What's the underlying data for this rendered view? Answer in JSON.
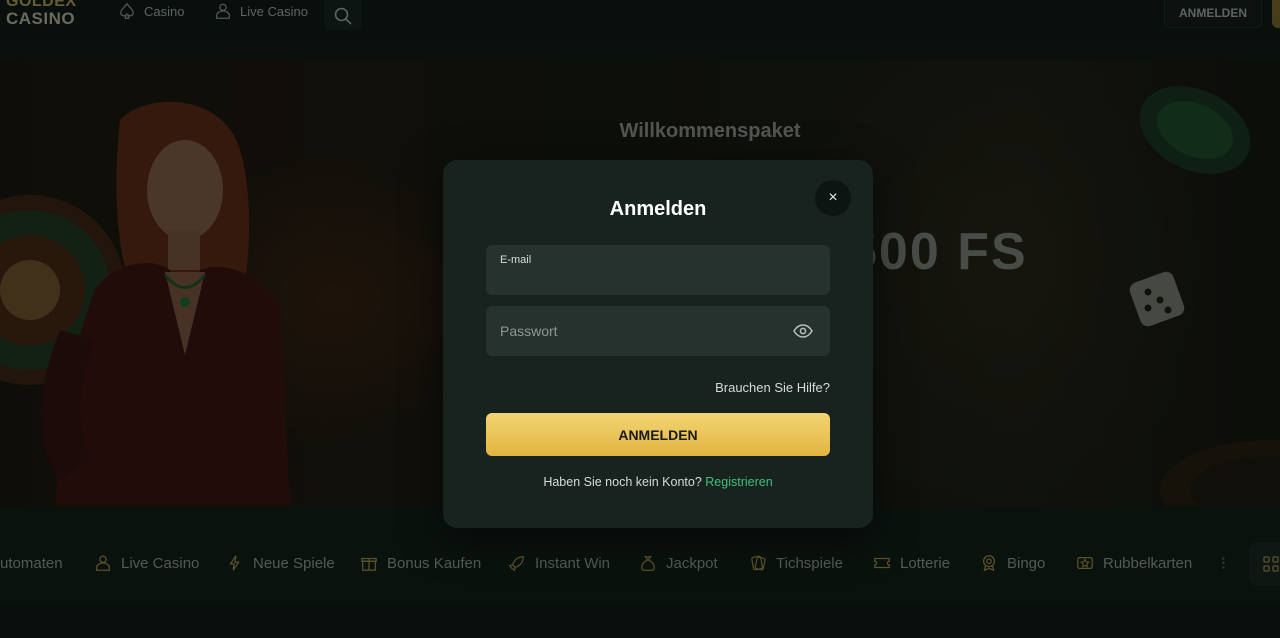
{
  "header": {
    "logo_line1": "GOLDEX",
    "logo_line2": "CASINO",
    "nav": [
      {
        "label": "Casino",
        "icon": "spade-icon"
      },
      {
        "label": "Live Casino",
        "icon": "dealer-icon"
      }
    ],
    "login_label": "ANMELDEN"
  },
  "hero": {
    "title": "Willkommenspaket",
    "big_text": "500 FS"
  },
  "modal": {
    "title": "Anmelden",
    "close_symbol": "×",
    "email_label": "E-mail",
    "email_value": "",
    "password_placeholder": "Passwort",
    "help_link": "Brauchen Sie Hilfe?",
    "submit_label": "ANMELDEN",
    "no_account_text": "Haben Sie noch kein Konto?",
    "register_link": "Registrieren"
  },
  "categories": [
    {
      "label": "Automaten",
      "icon": "slot-icon"
    },
    {
      "label": "Live Casino",
      "icon": "dealer-icon"
    },
    {
      "label": "Neue Spiele",
      "icon": "lightning-icon"
    },
    {
      "label": "Bonus Kaufen",
      "icon": "gift-icon"
    },
    {
      "label": "Instant Win",
      "icon": "rocket-icon"
    },
    {
      "label": "Jackpot",
      "icon": "money-bag-icon"
    },
    {
      "label": "Tichspiele",
      "icon": "cards-icon"
    },
    {
      "label": "Lotterie",
      "icon": "ticket-icon"
    },
    {
      "label": "Bingo",
      "icon": "bingo-icon"
    },
    {
      "label": "Rubbelkarten",
      "icon": "scratch-card-icon"
    }
  ],
  "colors": {
    "accent_gold": "#e8bd4c",
    "register_green": "#3fc07a",
    "modal_bg": "#18221e"
  }
}
